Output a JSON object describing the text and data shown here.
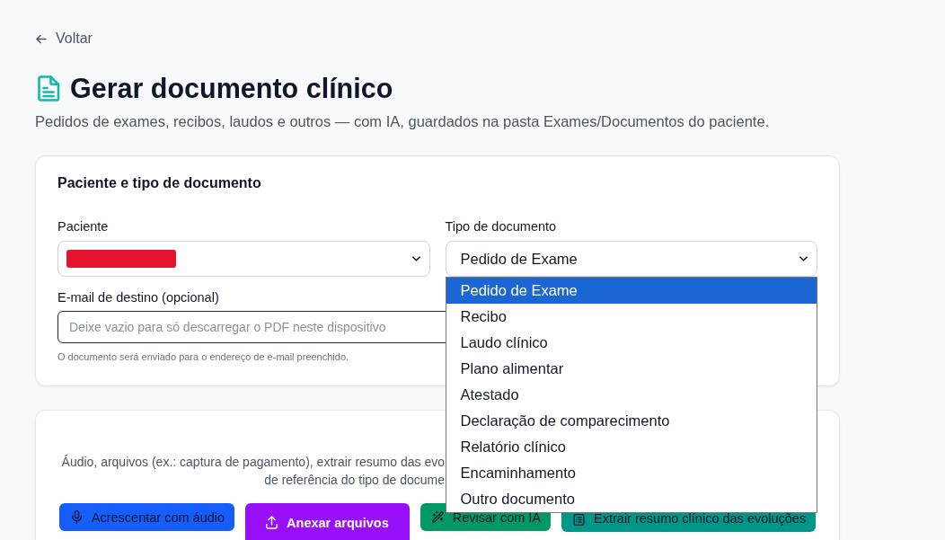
{
  "back_link": {
    "label": "Voltar"
  },
  "header": {
    "title": "Gerar documento clínico",
    "subtitle": "Pedidos de exames, recibos, laudos e outros — com IA, guardados na pasta Exames/Documentos do paciente."
  },
  "patient_card": {
    "title": "Paciente e tipo de documento",
    "patient_field": {
      "label": "Paciente",
      "redacted": true
    },
    "document_type_field": {
      "label": "Tipo de documento",
      "value": "Pedido de Exame",
      "expanded": true,
      "options": [
        {
          "label": "Pedido de Exame",
          "selected": true
        },
        {
          "label": "Recibo",
          "selected": false
        },
        {
          "label": "Laudo clínico",
          "selected": false
        },
        {
          "label": "Plano alimentar",
          "selected": false
        },
        {
          "label": "Atestado",
          "selected": false
        },
        {
          "label": "Declaração de comparecimento",
          "selected": false
        },
        {
          "label": "Relatório clínico",
          "selected": false
        },
        {
          "label": "Encaminhamento",
          "selected": false
        },
        {
          "label": "Outro documento",
          "selected": false
        }
      ]
    },
    "email_field": {
      "label": "E-mail de destino (opcional)",
      "placeholder": "Deixe vazio para só descarregar o PDF neste dispositivo",
      "hint": "O documento será enviado para o endereço de e-mail preenchido."
    }
  },
  "sources_card": {
    "description": [
      "Áudio, arquivos (ex.: captura de pagamento), extrair resumo das evo",
      "de referência do tipo de docume"
    ],
    "buttons": [
      {
        "kind": "audio",
        "label": "Acrescentar com áudio",
        "color": "#155dfc"
      },
      {
        "kind": "upload",
        "label": "Anexar arquivos",
        "color": "#9810fa"
      },
      {
        "kind": "ai_review",
        "label": "Revisar com IA",
        "color": "#009966"
      },
      {
        "kind": "summary",
        "label": "Extrair resumo clínico das evoluções",
        "color": "#009689"
      }
    ]
  }
}
